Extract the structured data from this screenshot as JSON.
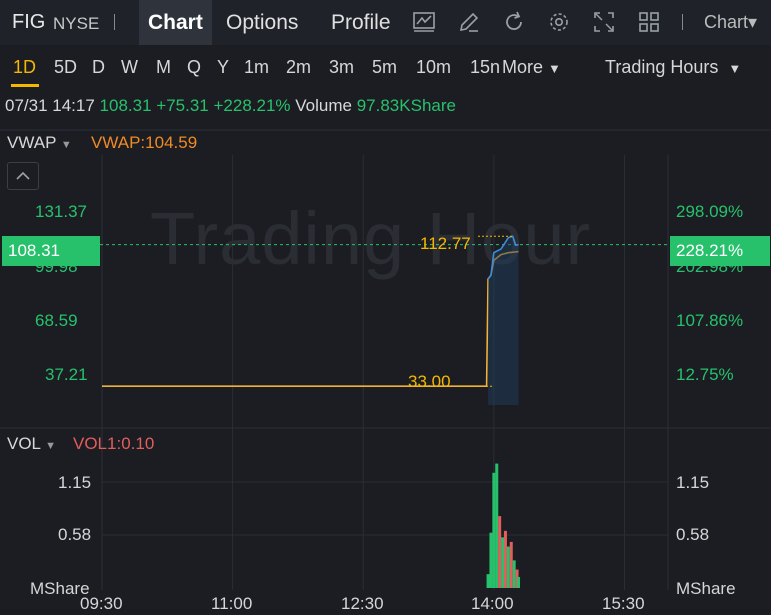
{
  "header": {
    "symbol": "FIG",
    "exchange": "NYSE",
    "tabs": [
      "Chart",
      "Options",
      "Profile"
    ],
    "active_tab": "Chart",
    "chart_type_label": "Chart"
  },
  "timeframes": [
    "1D",
    "5D",
    "D",
    "W",
    "M",
    "Q",
    "Y",
    "1m",
    "2m",
    "3m",
    "5m",
    "10m",
    "15n"
  ],
  "more_label": "More",
  "active_timeframe": "1D",
  "session_selector": "Trading Hours",
  "quote": {
    "datetime": "07/31 14:17",
    "price": "108.31",
    "change": "+75.31",
    "change_pct": "+228.21%",
    "volume_label": "Volume",
    "volume_value": "97.83KShare"
  },
  "price_panel": {
    "indicator": "VWAP",
    "indicator_value": "VWAP:104.59",
    "watermark": "Trading Hour",
    "last_price_badge": "108.31",
    "last_pct_badge": "228.21%",
    "high_label": "112.77",
    "low_label": "33.00",
    "y_ticks_left": [
      "131.37",
      "99.98",
      "68.59",
      "37.21"
    ],
    "y_ticks_right": [
      "298.09%",
      "202.98%",
      "107.86%",
      "12.75%"
    ]
  },
  "volume_panel": {
    "indicator": "VOL",
    "indicator_value": "VOL1:0.10",
    "y_ticks_left": [
      "1.15",
      "0.58",
      "MShare"
    ],
    "y_ticks_right": [
      "1.15",
      "0.58",
      "MShare"
    ]
  },
  "x_ticks": [
    "09:30",
    "11:00",
    "12:30",
    "14:00",
    "15:30"
  ],
  "colors": {
    "up": "#27c16c",
    "down": "#e35d5d",
    "accent": "#f5b800",
    "vwap": "#f08a24",
    "price_line": "#3d8bd9"
  },
  "chart_data": {
    "type": "line",
    "series": [
      {
        "name": "",
        "x": [
          "09:30",
          "13:55",
          "13:56",
          "13:58",
          "14:00",
          "14:05",
          "14:10",
          "14:13",
          "14:15",
          "14:17"
        ],
        "values": [
          null,
          null,
          90.0,
          92.0,
          104.0,
          106.0,
          112.0,
          112.77,
          108.0,
          108.31
        ]
      },
      {
        "name": "VWAP",
        "x": [
          "09:30",
          "13:55",
          "13:56",
          "13:58",
          "14:00",
          "14:05",
          "14:10",
          "14:17"
        ],
        "values": [
          33.0,
          33.0,
          90.0,
          92.0,
          100.0,
          103.0,
          104.0,
          104.59
        ]
      }
    ],
    "volume": {
      "x": [
        "13:56",
        "13:58",
        "14:00",
        "14:02",
        "14:04",
        "14:06",
        "14:08",
        "14:10",
        "14:12",
        "14:14",
        "14:16",
        "14:17"
      ],
      "values": [
        0.15,
        0.6,
        1.25,
        1.35,
        0.78,
        0.55,
        0.62,
        0.45,
        0.5,
        0.3,
        0.2,
        0.12
      ],
      "directions": [
        "up",
        "up",
        "up",
        "up",
        "down",
        "up",
        "down",
        "up",
        "down",
        "up",
        "down",
        "up"
      ]
    },
    "ylim": [
      23.0,
      140.0
    ],
    "x_range": [
      "09:30",
      "16:00"
    ]
  }
}
